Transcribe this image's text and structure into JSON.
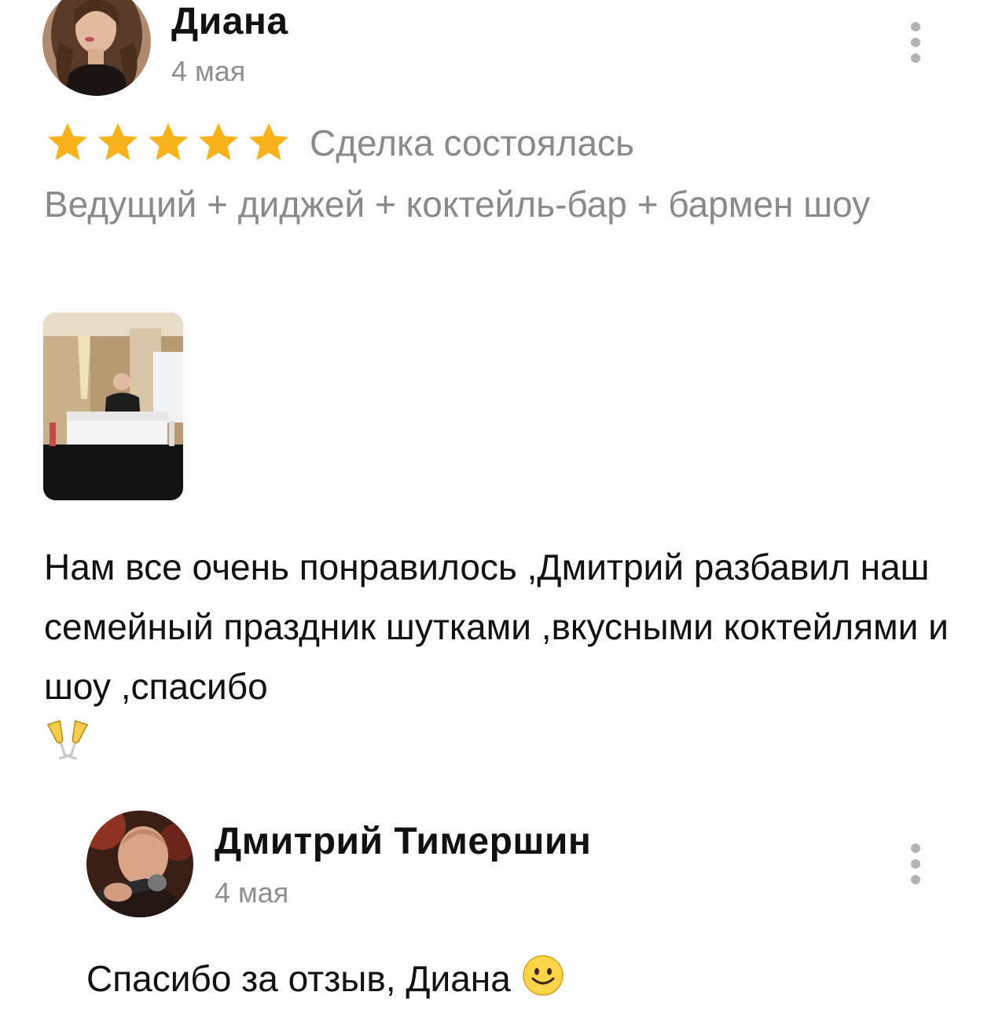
{
  "review": {
    "author": "Диана",
    "date": "4 мая",
    "rating": 5,
    "rating_max": 5,
    "deal_status": "Сделка состоялась",
    "service": "Ведущий + диджей + коктейль-бар + бармен шоу",
    "photos": [
      "bar-photo"
    ],
    "text": "Нам все очень понравилось ,Дмитрий разбавил наш семейный праздник шутками ,вкусными коктейлями и шоу ,спасибо",
    "text_emoji": "clinking-glasses-icon",
    "star_color": "#F7B21C"
  },
  "reply": {
    "author": "Дмитрий Тимершин",
    "date": "4 мая",
    "text": "Спасибо за отзыв, Диана",
    "text_emoji": "smiling-face-icon"
  },
  "icons": {
    "more": "more-vertical-icon",
    "star": "star-icon"
  }
}
